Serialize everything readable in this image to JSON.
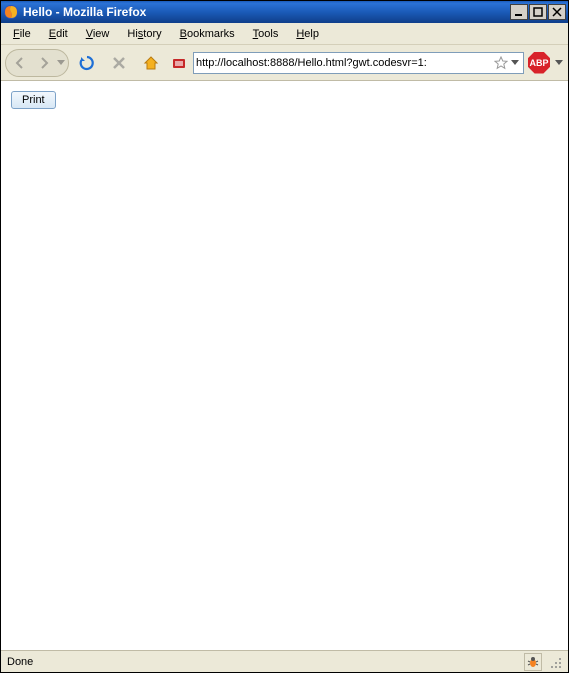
{
  "window": {
    "title": "Hello - Mozilla Firefox",
    "controls": {
      "minimize": "–",
      "maximize": "▢",
      "close": "✕"
    }
  },
  "menu": {
    "file": "File",
    "edit": "Edit",
    "view": "View",
    "history": "History",
    "bookmarks": "Bookmarks",
    "tools": "Tools",
    "help": "Help"
  },
  "toolbar": {
    "url": "http://localhost:8888/Hello.html?gwt.codesvr=1:",
    "abp_label": "ABP"
  },
  "page": {
    "print_button": "Print"
  },
  "status": {
    "text": "Done"
  }
}
